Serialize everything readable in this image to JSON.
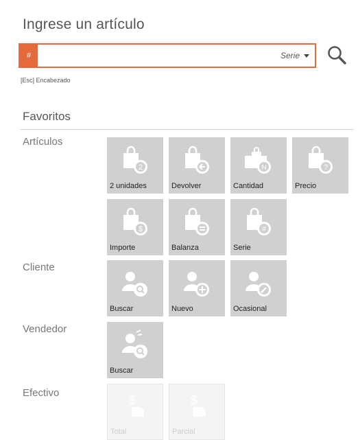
{
  "header": {
    "title": "Ingrese un artículo"
  },
  "search": {
    "prefix": "#",
    "value": "",
    "placeholder": "",
    "mode": "Serie"
  },
  "hint": "[Esc] Encabezado",
  "favorites": {
    "title": "Favoritos",
    "groups": [
      {
        "label": "Artículos",
        "tiles": [
          {
            "label": "2 unidades",
            "icon": "bag-number-2-icon"
          },
          {
            "label": "Devolver",
            "icon": "bag-return-icon"
          },
          {
            "label": "Cantidad",
            "icon": "bags-quantity-icon"
          },
          {
            "label": "Precio",
            "icon": "bag-question-icon"
          },
          {
            "label": "Importe",
            "icon": "bag-dollar-icon"
          },
          {
            "label": "Balanza",
            "icon": "bag-scale-icon"
          },
          {
            "label": "Serie",
            "icon": "bag-hash-icon"
          }
        ]
      },
      {
        "label": "Cliente",
        "tiles": [
          {
            "label": "Buscar",
            "icon": "person-search-icon"
          },
          {
            "label": "Nuevo",
            "icon": "person-add-icon"
          },
          {
            "label": "Ocasional",
            "icon": "person-edit-icon"
          }
        ]
      },
      {
        "label": "Vendedor",
        "tiles": [
          {
            "label": "Buscar",
            "icon": "salesperson-search-icon"
          }
        ]
      },
      {
        "label": "Efectivo",
        "tiles": [
          {
            "label": "Total",
            "icon": "cash-hand-icon",
            "disabled": true
          },
          {
            "label": "Parcial",
            "icon": "cash-hand-partial-icon",
            "disabled": true
          }
        ]
      }
    ]
  },
  "colors": {
    "accent": "#e46a3c",
    "tile_bg": "#d0d0d0",
    "tile_disabled_bg": "#f4f4f4"
  }
}
